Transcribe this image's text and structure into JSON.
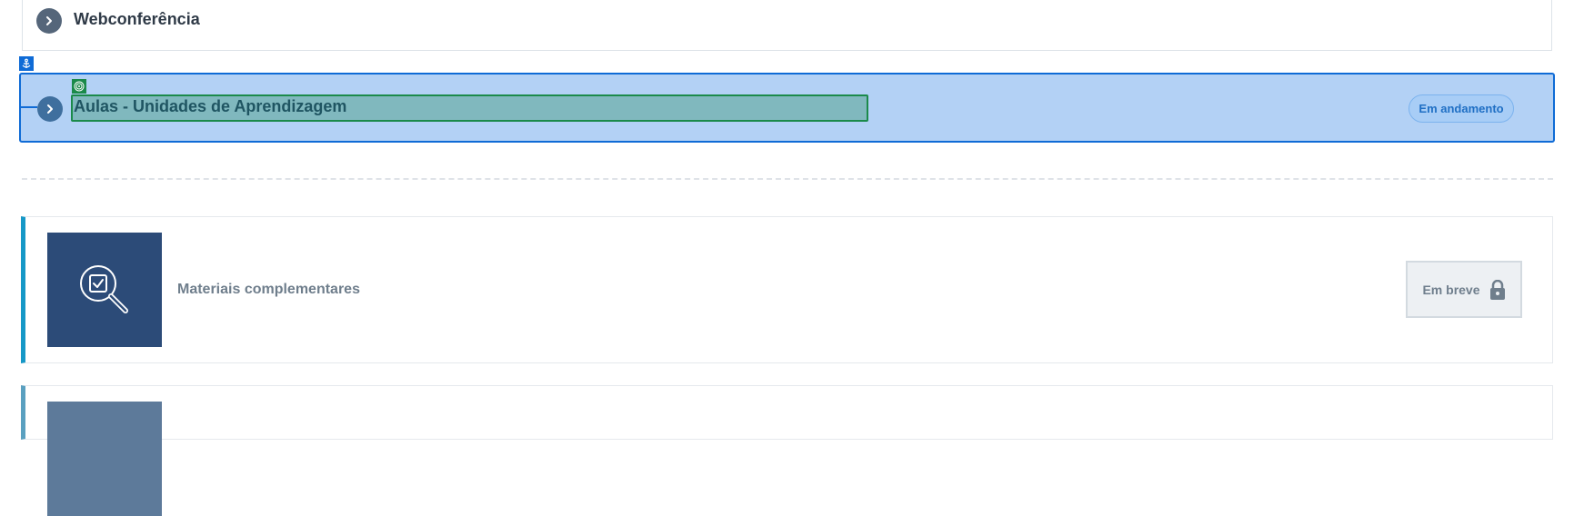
{
  "sections": [
    {
      "title": "Webconferência"
    },
    {
      "title": "Aulas - Unidades de Aprendizagem",
      "status": "Em andamento"
    }
  ],
  "activities": [
    {
      "title": "Materiais complementares",
      "action_label": "Em breve",
      "icon": "search-check-icon",
      "accent": "#1698c7",
      "thumb_color": "#2c4b78"
    },
    {
      "title": "",
      "accent": "#5aa0c0",
      "thumb_color": "#5d7a9a"
    }
  ],
  "colors": {
    "selection": "#0f6bd6",
    "selection_fill": "#b3d1f5",
    "target": "#1b8a4a"
  }
}
